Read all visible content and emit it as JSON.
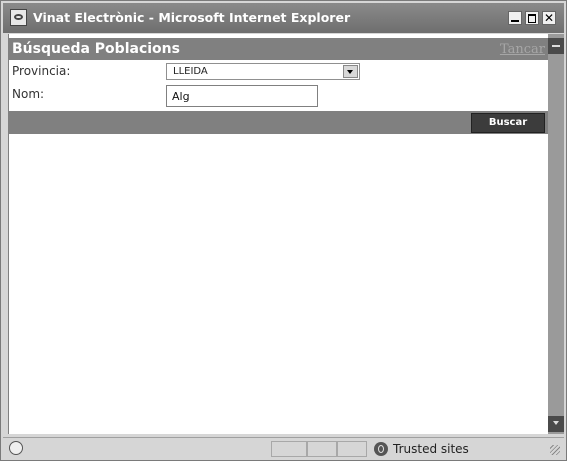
{
  "window": {
    "title": "Vinat Electrònic - Microsoft Internet Explorer",
    "minimize_icon": "minimize-icon",
    "maximize_icon": "maximize-icon",
    "close_glyph": "✕"
  },
  "header": {
    "title": "Búsqueda Poblacions",
    "close_link": "Tancar"
  },
  "form": {
    "provincia_label": "Provincia:",
    "provincia_value": "LLEIDA",
    "nom_label": "Nom:",
    "nom_value": "Alg"
  },
  "actions": {
    "search_label": "Buscar"
  },
  "statusbar": {
    "zone_label": "Trusted sites",
    "zone_icon": "trusted-sites-icon",
    "page_icon": "ie-page-icon"
  },
  "colors": {
    "header_bg": "#808080",
    "button_bg": "#3c3c3c"
  }
}
